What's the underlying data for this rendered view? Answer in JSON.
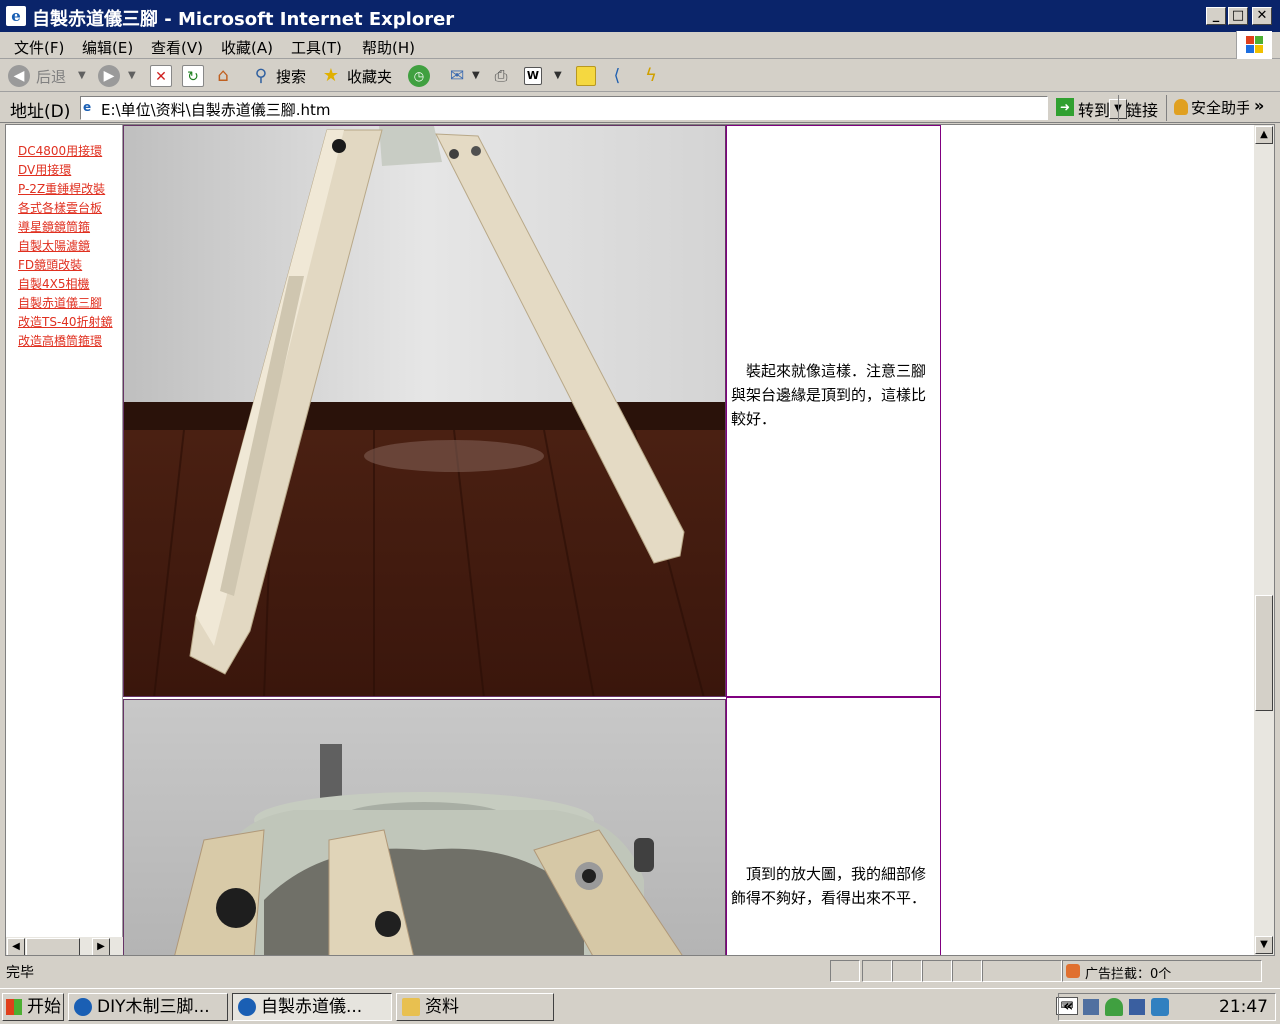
{
  "window": {
    "title": "自製赤道儀三腳 - Microsoft Internet Explorer",
    "icon_name": "ie-icon"
  },
  "menu": [
    "文件(F)",
    "编辑(E)",
    "查看(V)",
    "收藏(A)",
    "工具(T)",
    "帮助(H)"
  ],
  "toolbar": {
    "back": "后退",
    "search": "搜索",
    "favorites": "收藏夹"
  },
  "address": {
    "label": "地址(D)",
    "value": "E:\\单位\\资料\\自製赤道儀三腳.htm",
    "go": "转到",
    "links": "链接",
    "security": "安全助手"
  },
  "nav_links": [
    "DC4800用接環",
    "DV用接環",
    "P-2Z重錘桿改裝",
    "各式各樣雲台板",
    "導星鏡鏡筒箍",
    "自製太陽濾鏡",
    "FD鏡頭改裝",
    "自製4X5相機",
    "自製赤道儀三腳",
    "改造TS-40折射鏡",
    "改造高橋筒箍環"
  ],
  "cells": [
    {
      "text": "裝起來就像這樣．注意三腳與架台邊緣是頂到的，這樣比較好．"
    },
    {
      "text": "頂到的放大圖，我的細部修飾得不夠好，看得出來不平．"
    }
  ],
  "status": {
    "text": "完毕",
    "popup_blocker": "广告拦截：0个"
  },
  "taskbar": {
    "start": "开始",
    "tasks": [
      "DIY木制三脚...",
      "自製赤道儀...",
      "资料"
    ],
    "clock": "21:47"
  },
  "colors": {
    "titlebar": "#0a246a",
    "link": "#e03020",
    "cell_border": "#800080"
  }
}
